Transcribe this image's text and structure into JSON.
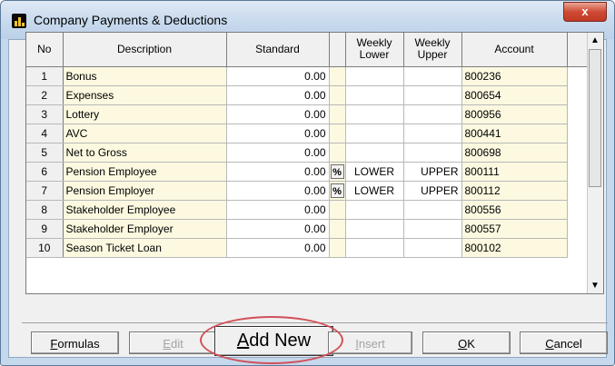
{
  "window": {
    "title": "Company Payments & Deductions",
    "close_glyph": "x"
  },
  "grid": {
    "headers": {
      "no": "No",
      "description": "Description",
      "standard": "Standard",
      "weekly_lower": [
        "Weekly",
        "Lower"
      ],
      "weekly_upper": [
        "Weekly",
        "Upper"
      ],
      "account": "Account"
    },
    "rows": [
      {
        "no": "1",
        "description": "Bonus",
        "standard": "0.00",
        "pct": "",
        "lower": "",
        "upper": "",
        "account": "800236"
      },
      {
        "no": "2",
        "description": "Expenses",
        "standard": "0.00",
        "pct": "",
        "lower": "",
        "upper": "",
        "account": "800654"
      },
      {
        "no": "3",
        "description": "Lottery",
        "standard": "0.00",
        "pct": "",
        "lower": "",
        "upper": "",
        "account": "800956"
      },
      {
        "no": "4",
        "description": "AVC",
        "standard": "0.00",
        "pct": "",
        "lower": "",
        "upper": "",
        "account": "800441"
      },
      {
        "no": "5",
        "description": "Net to Gross",
        "standard": "0.00",
        "pct": "",
        "lower": "",
        "upper": "",
        "account": "800698"
      },
      {
        "no": "6",
        "description": "Pension Employee",
        "standard": "0.00",
        "pct": "%",
        "lower": "LOWER",
        "upper": "UPPER",
        "account": "800111"
      },
      {
        "no": "7",
        "description": "Pension Employer",
        "standard": "0.00",
        "pct": "%",
        "lower": "LOWER",
        "upper": "UPPER",
        "account": "800112"
      },
      {
        "no": "8",
        "description": "Stakeholder Employee",
        "standard": "0.00",
        "pct": "",
        "lower": "",
        "upper": "",
        "account": "800556"
      },
      {
        "no": "9",
        "description": "Stakeholder Employer",
        "standard": "0.00",
        "pct": "",
        "lower": "",
        "upper": "",
        "account": "800557"
      },
      {
        "no": "10",
        "description": "Season Ticket Loan",
        "standard": "0.00",
        "pct": "",
        "lower": "",
        "upper": "",
        "account": "800102"
      }
    ]
  },
  "buttons": {
    "formulas": {
      "mnemonic": "F",
      "rest": "ormulas"
    },
    "edit": {
      "mnemonic": "E",
      "rest": "dit"
    },
    "add_new": {
      "mnemonic": "A",
      "rest": "dd New"
    },
    "insert": {
      "mnemonic": "I",
      "rest": "nsert"
    },
    "ok": {
      "mnemonic": "O",
      "rest": "K"
    },
    "cancel": {
      "mnemonic": "C",
      "rest": "ancel"
    }
  },
  "scrollbar": {
    "up": "▲",
    "down": "▼"
  },
  "colors": {
    "highlight_circle": "#d2505a",
    "grid_yellow": "#fcf9e0",
    "title_bar": "#c9dbee"
  }
}
